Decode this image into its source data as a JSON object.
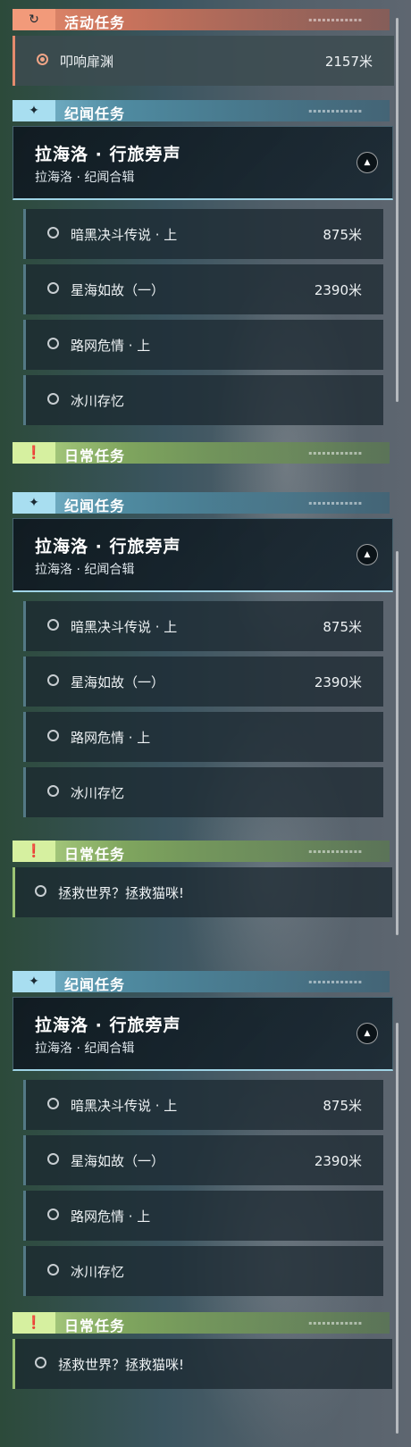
{
  "activity": {
    "header": "活动任务",
    "icon": "refresh-icon",
    "item": {
      "name": "叩响扉渊",
      "distance": "2157米"
    }
  },
  "story": {
    "header": "纪闻任务",
    "icon": "star-sparkle-icon",
    "group_title": "拉海洛 · 行旅旁声",
    "group_subtitle": "拉海洛 · 纪闻合辑",
    "collapse_icon": "chevron-up-icon",
    "quests": [
      {
        "name": "暗黑决斗传说 · 上",
        "distance": "875米"
      },
      {
        "name": "星海如故（一）",
        "distance": "2390米"
      },
      {
        "name": "路网危情 · 上",
        "distance": ""
      },
      {
        "name": "冰川存忆",
        "distance": ""
      }
    ]
  },
  "daily": {
    "header": "日常任务",
    "icon": "exclamation-box-icon",
    "quest": {
      "name": "拯救世界？拯救猫咪!"
    }
  },
  "colors": {
    "activity_accent": "#e38b6d",
    "story_accent": "#7fbcd2",
    "daily_accent": "#b6d789"
  }
}
